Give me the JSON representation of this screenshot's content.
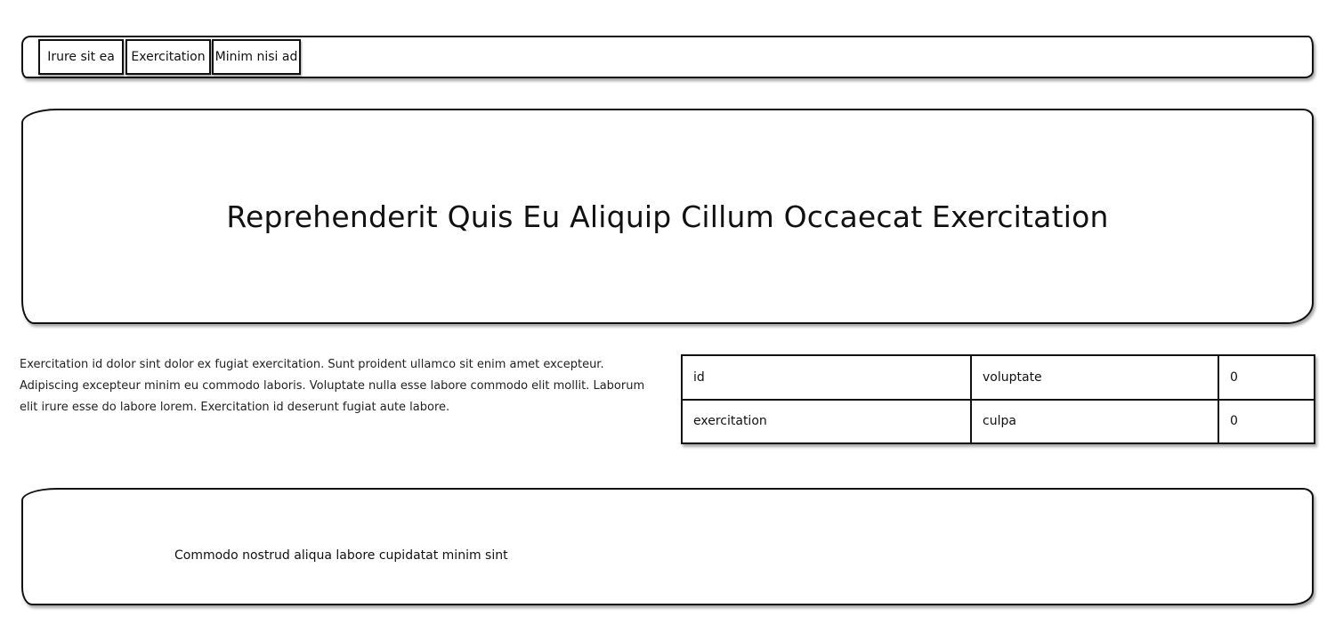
{
  "navbar": {
    "items": [
      {
        "label": "Irure sit ea"
      },
      {
        "label": "Exercitation"
      },
      {
        "label": "Minim nisi ad"
      }
    ]
  },
  "hero": {
    "title": "Reprehenderit Quis Eu Aliquip Cillum Occaecat Exercitation"
  },
  "content": {
    "paragraph": "Exercitation id dolor sint dolor ex fugiat exercitation. Sunt proident ullamco sit enim amet excepteur. Adipiscing excepteur minim eu commodo laboris. Voluptate nulla esse labore commodo elit mollit. Laborum elit irure esse do labore lorem. Exercitation id deserunt fugiat aute labore."
  },
  "table": {
    "rows": [
      [
        "id",
        "voluptate",
        "0"
      ],
      [
        "exercitation",
        "culpa",
        "0"
      ]
    ]
  },
  "footer": {
    "text": "Commodo nostrud aliqua labore cupidatat minim sint"
  }
}
